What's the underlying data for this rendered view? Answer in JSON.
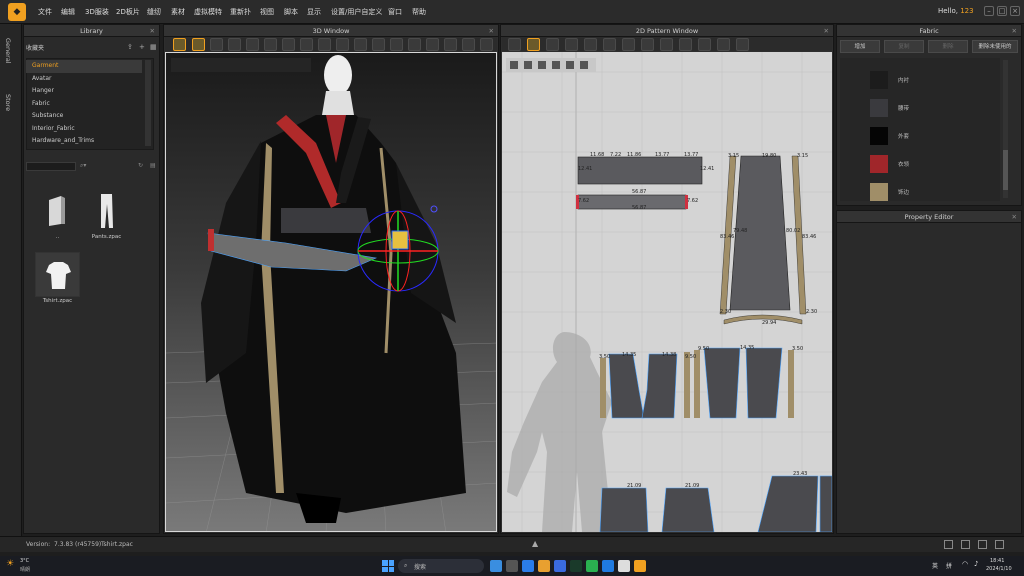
{
  "menubar": {
    "items": [
      "文件",
      "编辑",
      "3D服装",
      "2D板片",
      "缝纫",
      "素材",
      "虚拟模特",
      "重新扑",
      "视图",
      "脚本",
      "显示",
      "设置/用户自定义",
      "窗口",
      "帮助"
    ],
    "greeting_prefix": "Hello,",
    "greeting_user": "123"
  },
  "vtabs": [
    "General",
    "Store"
  ],
  "library": {
    "title": "Library",
    "favorites_label": "收藏夹",
    "items": [
      "Garment",
      "Avatar",
      "Hanger",
      "Fabric",
      "Substance",
      "Interior_Fabric",
      "Hardware_and_Trims"
    ],
    "selected_index": 0,
    "thumbs": [
      {
        "label": "..",
        "icon": "folder-icon"
      },
      {
        "label": "Pants.zpac",
        "icon": "pants-icon"
      },
      {
        "label": "Tshirt.zpac",
        "icon": "tshirt-icon"
      }
    ]
  },
  "window3d": {
    "title": "3D Window"
  },
  "window2d": {
    "title": "2D Pattern Window"
  },
  "pattern_labels": {
    "top_strip": [
      "11.68",
      "7.22",
      "11.86",
      "13.77",
      "13.77"
    ],
    "mid_strip": [
      "12.41",
      "12.41"
    ],
    "belt": [
      "56.87",
      "56.87",
      "7.62",
      "7.62"
    ],
    "skirt": [
      "3.15",
      "19.80",
      "3.15",
      "79.48",
      "80.02",
      "83.46",
      "83.46",
      "29.94",
      "2.30",
      "2.30"
    ],
    "bodices": [
      "3.50",
      "14.35",
      "14.38",
      "9.50",
      "9.50",
      "14.35",
      "3.50"
    ],
    "bottom": [
      "21.09",
      "21.09",
      "23.43"
    ]
  },
  "fabric": {
    "title": "Fabric",
    "buttons": [
      "增加",
      "复制",
      "删除",
      "删除未使用的"
    ],
    "items": [
      {
        "name": "内衬",
        "color": "#1c1c1c"
      },
      {
        "name": "腰带",
        "color": "#3a3a3e"
      },
      {
        "name": "外套",
        "color": "#050505"
      },
      {
        "name": "衣领",
        "color": "#a0262a"
      },
      {
        "name": "饰边",
        "color": "#a08e68"
      }
    ]
  },
  "property_editor": {
    "title": "Property Editor"
  },
  "status": {
    "version_label": "Version:",
    "version": "7.3.83 (r45759)",
    "file": "Tshirt.zpac"
  },
  "taskbar": {
    "weather_temp": "3°C",
    "weather_desc": "晴朗",
    "search_placeholder": "搜索",
    "lang1": "英",
    "lang2": "拼",
    "time": "18:41",
    "date": "2024/1/10"
  },
  "colors": {
    "accent": "#f0a020",
    "selection_blue": "#4aa3ff"
  }
}
